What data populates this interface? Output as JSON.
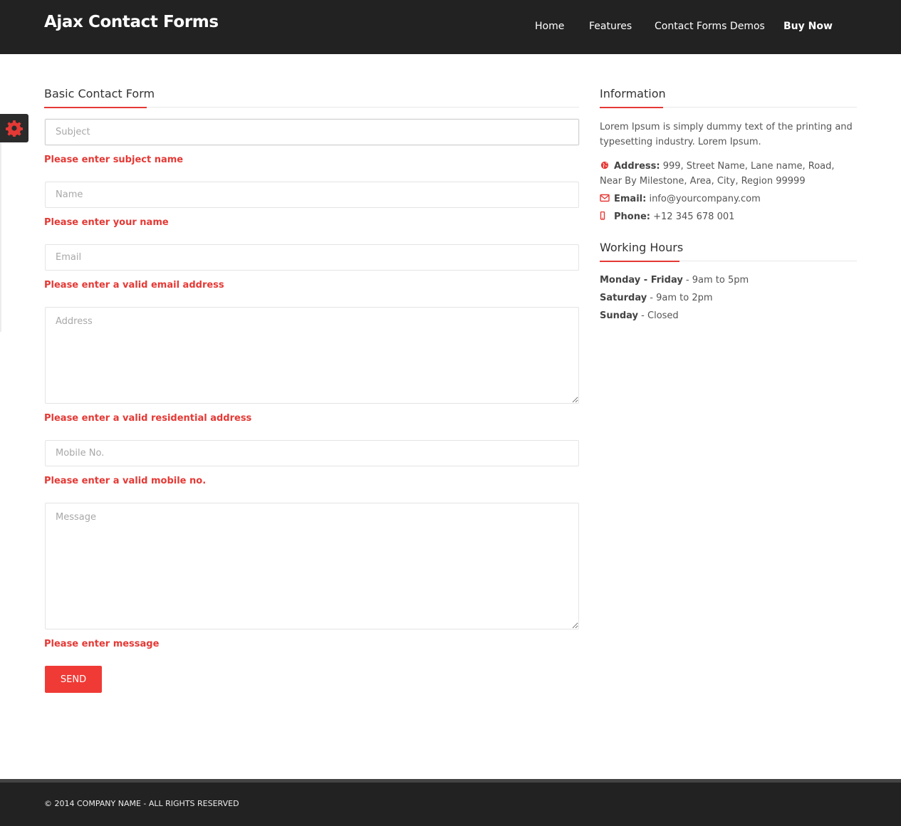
{
  "header": {
    "brand": "Ajax Contact Forms",
    "nav": [
      "Home",
      "Features",
      "Contact Forms Demos",
      "Buy Now"
    ]
  },
  "form": {
    "title": "Basic Contact Form",
    "fields": {
      "subject": {
        "placeholder": "Subject",
        "error": "Please enter subject name"
      },
      "name": {
        "placeholder": "Name",
        "error": "Please enter your name"
      },
      "email": {
        "placeholder": "Email",
        "error": "Please enter a valid email address"
      },
      "address": {
        "placeholder": "Address",
        "error": "Please enter a valid residential address"
      },
      "mobile": {
        "placeholder": "Mobile No.",
        "error": "Please enter a valid mobile no."
      },
      "message": {
        "placeholder": "Message",
        "error": "Please enter message"
      }
    },
    "send_label": "SEND"
  },
  "info": {
    "title": "Information",
    "intro": "Lorem Ipsum is simply dummy text of the printing and typesetting industry. Lorem Ipsum.",
    "address_label": "Address:",
    "address_value": "999, Street Name, Lane name, Road, Near By Milestone, Area, City, Region 99999",
    "email_label": "Email:",
    "email_value": "info@yourcompany.com",
    "phone_label": "Phone:",
    "phone_value": "+12 345 678 001"
  },
  "hours": {
    "title": "Working Hours",
    "rows": [
      {
        "day": "Monday - Friday",
        "time": "9am to 5pm"
      },
      {
        "day": "Saturday",
        "time": "9am to 2pm"
      },
      {
        "day": "Sunday",
        "time": "Closed"
      }
    ],
    "separator": " - "
  },
  "footer": {
    "copyright": "© 2014 COMPANY NAME - ALL RIGHTS RESERVED"
  },
  "colors": {
    "accent": "#e53935",
    "header_bg": "#222222",
    "button": "#f03a35"
  },
  "icons": [
    "gear-icon",
    "globe-icon",
    "envelope-icon",
    "mobile-phone-icon"
  ]
}
